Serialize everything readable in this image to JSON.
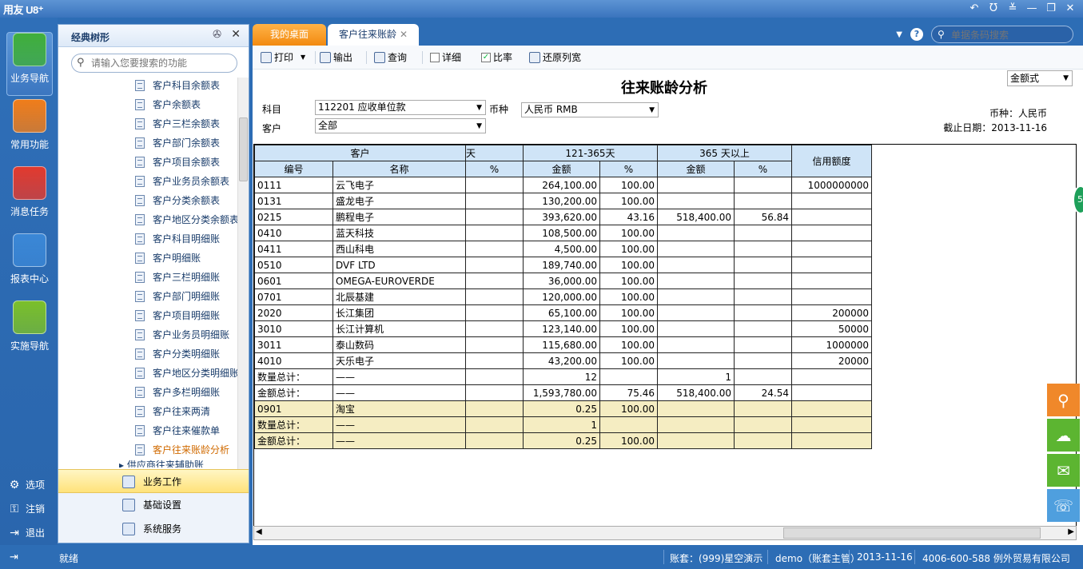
{
  "app": {
    "logo": "用友 U8⁺",
    "window_controls": [
      "↶",
      "Ʊ",
      "≚",
      "—",
      "❐",
      "✕"
    ]
  },
  "leftnav": {
    "items": [
      {
        "label": "业务导航",
        "icon": "business-nav-icon",
        "color": "#3fae3a",
        "active": true
      },
      {
        "label": "常用功能",
        "icon": "star-icon",
        "color": "#f07d1a"
      },
      {
        "label": "消息任务",
        "icon": "mail-icon",
        "color": "#e23a2e"
      },
      {
        "label": "报表中心",
        "icon": "report-icon",
        "color": "#3b87d6"
      },
      {
        "label": "实施导航",
        "icon": "compass-icon",
        "color": "#7bbf2a"
      }
    ],
    "bottom": [
      {
        "label": "选项",
        "icon": "⚙"
      },
      {
        "label": "注销",
        "icon": "⚿"
      },
      {
        "label": "退出",
        "icon": "⇥"
      }
    ]
  },
  "tree": {
    "title": "经典树形",
    "search_placeholder": "请输入您要搜索的功能",
    "items": [
      "客户科目余额表",
      "客户余额表",
      "客户三栏余额表",
      "客户部门余额表",
      "客户项目余额表",
      "客户业务员余额表",
      "客户分类余额表",
      "客户地区分类余额表",
      "客户科目明细账",
      "客户明细账",
      "客户三栏明细账",
      "客户部门明细账",
      "客户项目明细账",
      "客户业务员明细账",
      "客户分类明细账",
      "客户地区分类明细账",
      "客户多栏明细账",
      "客户往来两清",
      "客户往来催款单",
      "客户往来账龄分析"
    ],
    "active_index": 19,
    "partial_item": "▸ 供应商往来辅助账",
    "bottom_items": [
      "业务工作",
      "基础设置",
      "系统服务"
    ]
  },
  "tabs": [
    {
      "label": "我的桌面"
    },
    {
      "label": "客户往来账龄"
    }
  ],
  "barcode_placeholder": "单据条码搜索",
  "toolbar": {
    "print": "打印",
    "export": "输出",
    "query": "查询",
    "detail": "详细",
    "ratio": "比率",
    "restore_cols": "还原列宽",
    "detail_checked": false,
    "ratio_checked": true
  },
  "report": {
    "title": "往来账龄分析",
    "format_select": "金额式",
    "subject_label": "科目",
    "subject_value": "112201 应收单位款",
    "currency_label": "币种",
    "currency_value": "人民币 RMB",
    "customer_label": "客户",
    "customer_value": "全部",
    "currency_info": "币种：人民币",
    "cutoff_info": "截止日期：2013-11-16"
  },
  "table": {
    "group_headers": [
      "客户",
      "天",
      "121-365天",
      "365 天以上",
      "信用额度"
    ],
    "sub_headers": [
      "编号",
      "名称",
      "%",
      "金额",
      "%",
      "金额",
      "%"
    ],
    "rows": [
      {
        "c": [
          "0111",
          "云飞电子",
          "",
          "264,100.00",
          "100.00",
          "",
          "",
          "1000000000"
        ]
      },
      {
        "c": [
          "0131",
          "盛龙电子",
          "",
          "130,200.00",
          "100.00",
          "",
          "",
          ""
        ]
      },
      {
        "c": [
          "0215",
          "鹏程电子",
          "",
          "393,620.00",
          "43.16",
          "518,400.00",
          "56.84",
          ""
        ]
      },
      {
        "c": [
          "0410",
          "蓝天科技",
          "",
          "108,500.00",
          "100.00",
          "",
          "",
          ""
        ]
      },
      {
        "c": [
          "0411",
          "西山科电",
          "",
          "4,500.00",
          "100.00",
          "",
          "",
          ""
        ]
      },
      {
        "c": [
          "0510",
          "DVF LTD",
          "",
          "189,740.00",
          "100.00",
          "",
          "",
          ""
        ]
      },
      {
        "c": [
          "0601",
          "OMEGA-EUROVERDE",
          "",
          "36,000.00",
          "100.00",
          "",
          "",
          ""
        ]
      },
      {
        "c": [
          "0701",
          "北辰基建",
          "",
          "120,000.00",
          "100.00",
          "",
          "",
          ""
        ]
      },
      {
        "c": [
          "2020",
          "长江集团",
          "",
          "65,100.00",
          "100.00",
          "",
          "",
          "200000"
        ]
      },
      {
        "c": [
          "3010",
          "长江计算机",
          "",
          "123,140.00",
          "100.00",
          "",
          "",
          "50000"
        ]
      },
      {
        "c": [
          "3011",
          "泰山数码",
          "",
          "115,680.00",
          "100.00",
          "",
          "",
          "1000000"
        ]
      },
      {
        "c": [
          "4010",
          "天乐电子",
          "",
          "43,200.00",
          "100.00",
          "",
          "",
          "20000"
        ]
      },
      {
        "c": [
          "数量总计：",
          "——",
          "",
          "12",
          "",
          "1",
          "",
          ""
        ]
      },
      {
        "c": [
          "金额总计：",
          "——",
          "",
          "1,593,780.00",
          "75.46",
          "518,400.00",
          "24.54",
          ""
        ]
      },
      {
        "c": [
          "0901",
          "淘宝",
          "",
          "0.25",
          "100.00",
          "",
          "",
          ""
        ],
        "hl": true
      },
      {
        "c": [
          "数量总计：",
          "——",
          "",
          "1",
          "",
          "",
          "",
          ""
        ],
        "hl": true
      },
      {
        "c": [
          "金额总计：",
          "——",
          "",
          "0.25",
          "100.00",
          "",
          "",
          ""
        ],
        "hl": true
      }
    ]
  },
  "status": {
    "ready": "就绪",
    "account": "账套：(999)星空演示",
    "user": "demo（账套主管）",
    "date": "2013-11-16",
    "company": "4006-600-588 例外贸易有限公司"
  },
  "fabs": [
    {
      "icon": "search-icon",
      "glyph": "⚲",
      "color": "#f0882a"
    },
    {
      "icon": "cloud-icon",
      "glyph": "☁",
      "color": "#5cb531"
    },
    {
      "icon": "chat-icon",
      "glyph": "✉",
      "color": "#5cb531"
    },
    {
      "icon": "support-icon",
      "glyph": "☏",
      "color": "#4f9fde"
    }
  ]
}
